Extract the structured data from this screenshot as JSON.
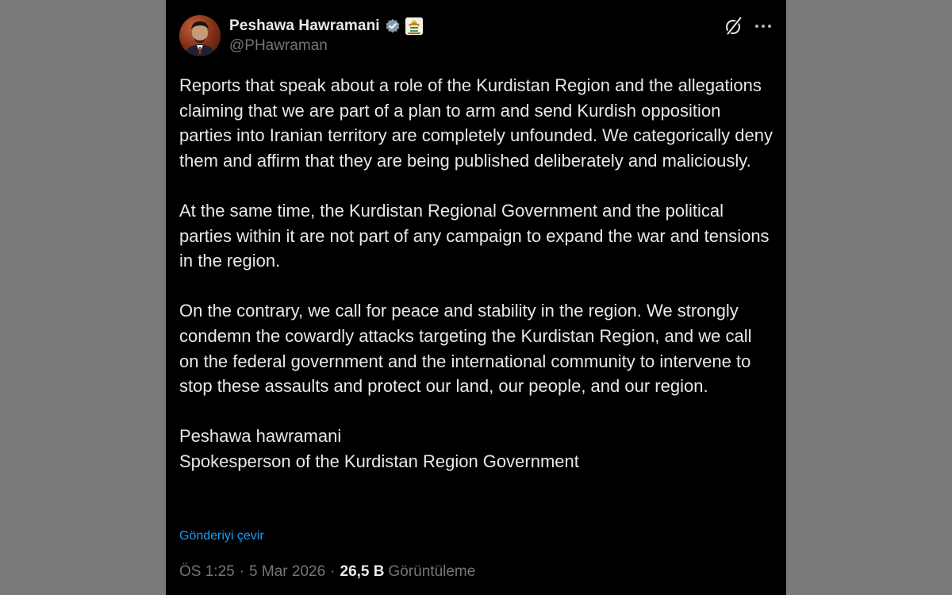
{
  "author": {
    "display_name": "Peshawa Hawramani",
    "handle": "@PHawraman",
    "avatar_icon": "profile-photo",
    "verified_icon": "verified-badge-icon",
    "verified_color": "#829aab",
    "affiliate_icon": "kurdistan-government-emblem-icon"
  },
  "header_actions": {
    "grok_icon": "grok-icon",
    "more_icon": "more-horizontal-icon"
  },
  "tweet": {
    "paragraphs": [
      "Reports that speak about a role of the Kurdistan Region and the allegations claiming that we are part of a plan to arm and send Kurdish opposition parties into Iranian territory are completely unfounded. We categorically deny them and affirm that they are being published deliberately and maliciously.",
      "At the same time, the Kurdistan Regional Government and the political parties within it are not part of any campaign to expand the war and tensions in the region.",
      "On the contrary, we call for peace and stability in the region. We strongly condemn the cowardly attacks targeting the Kurdistan Region, and we call on the federal government and the international community to intervene to stop these assaults and protect our land, our people, and our region."
    ],
    "signature_name": "Peshawa hawramani",
    "signature_title": "Spokesperson of the Kurdistan Region Government",
    "translate_label": "Gönderiyi çevir"
  },
  "meta": {
    "time": "ÖS 1:25",
    "separator": "·",
    "date": "5 Mar 2026",
    "views_count": "26,5 B",
    "views_label": "Görüntüleme"
  },
  "colors": {
    "background": "#7a797c",
    "card": "#000000",
    "text": "#e7e9ea",
    "muted": "#71767b",
    "link": "#1d9bf0"
  }
}
